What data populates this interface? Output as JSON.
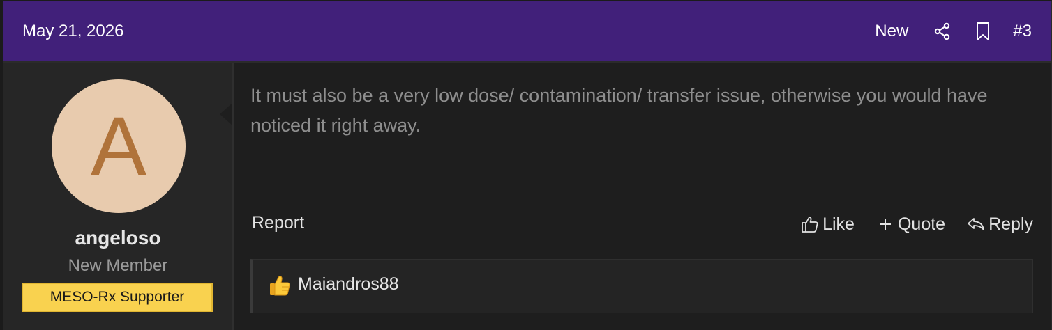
{
  "header": {
    "date": "May 21, 2026",
    "new_label": "New",
    "post_number": "#3",
    "icons": [
      "share-icon",
      "bookmark-icon"
    ]
  },
  "user": {
    "avatar_letter": "A",
    "name": "angeloso",
    "title": "New Member",
    "banner": "MESO-Rx Supporter"
  },
  "post": {
    "message": "It must also be a very low dose/ contamination/ transfer issue, otherwise you would have noticed it right away."
  },
  "actions": {
    "report": "Report",
    "like": "Like",
    "quote": "Quote",
    "reply": "Reply"
  },
  "reactions": {
    "emoji": "thumbs-up",
    "users": "Maiandros88"
  },
  "colors": {
    "header_bg": "#41207a",
    "body_bg": "#1e1e1e",
    "banner_bg": "#f9d24f",
    "avatar_bg": "#e8cbae",
    "avatar_letter": "#b0733a"
  }
}
